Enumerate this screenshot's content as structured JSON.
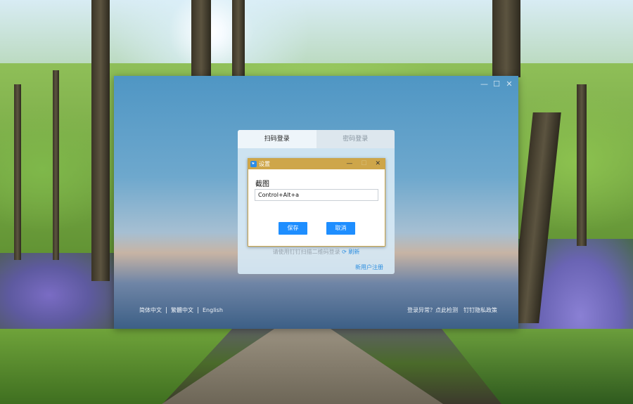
{
  "settings_dialog": {
    "title": "设置",
    "window_controls": [
      "—",
      "☐",
      "✕"
    ],
    "field_label": "截图",
    "shortcut_value": "Control+Alt+a",
    "save_label": "保存",
    "cancel_label": "取消"
  },
  "login": {
    "tabs": [
      "扫码登录",
      "密码登录"
    ],
    "qr_hint": "请使用钉钉扫描二维码登录",
    "refresh_label": "刷新",
    "register_label": "新用户注册"
  },
  "app_window_controls": [
    "—",
    "☐",
    "✕"
  ],
  "footer": {
    "languages": [
      "简体中文",
      "繁體中文",
      "English"
    ],
    "login_issue": "登录异常？点此检测",
    "privacy": "钉钉隐私政策"
  },
  "colors": {
    "dialog_titlebar": "#cea64a",
    "primary_button": "#1e8eff",
    "link": "#2f8fe0"
  }
}
